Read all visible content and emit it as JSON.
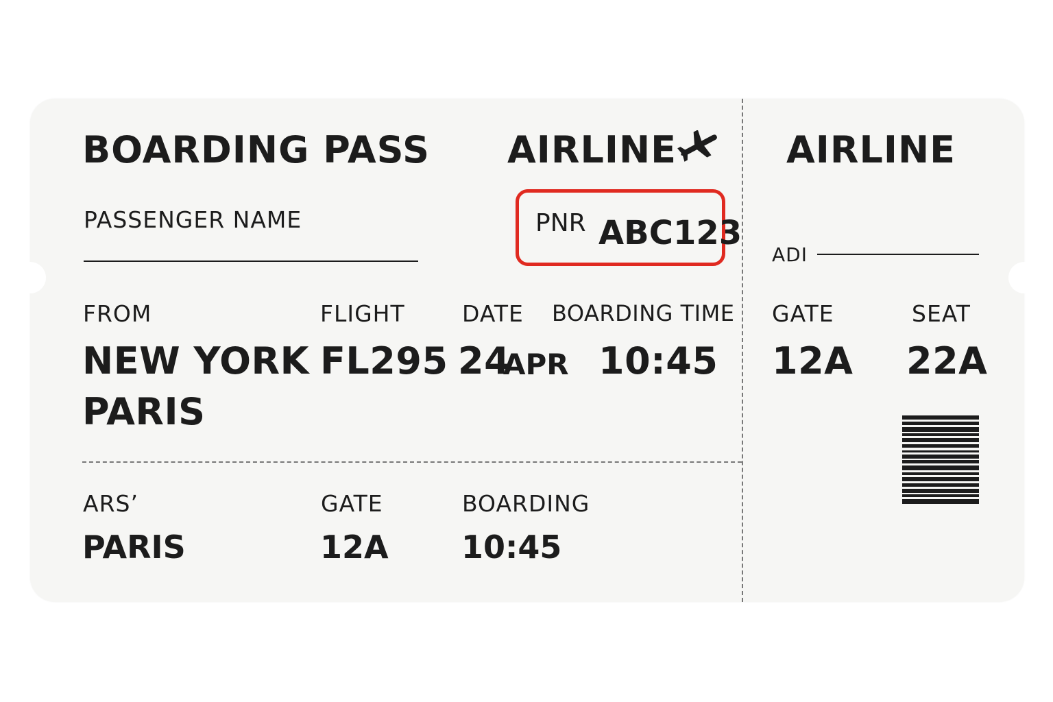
{
  "colors": {
    "pnr_highlight": "#e02a20",
    "ticket_bg": "#f6f6f4",
    "ink": "#1c1c1c"
  },
  "main": {
    "title": "BOARDING PASS",
    "airline": "AIRLINE",
    "airline_icon": "airplane-icon",
    "passenger_label": "PASSENGER NAME",
    "pnr_label": "PNR",
    "pnr_value": "ABC123",
    "from_label": "FROM",
    "from_value": "NEW YORK",
    "to_value": "PARIS",
    "flight_label": "FLIGHT",
    "flight_value": "FL295",
    "date_label": "DATE",
    "date_day": "24",
    "date_month": "APR",
    "boarding_time_label": "BOARDING TIME",
    "boarding_time_value": "10:45"
  },
  "lower": {
    "dest_label": "ARS’",
    "dest_value": "PARIS",
    "gate_label": "GATE",
    "gate_value": "12A",
    "boarding_label": "BOARDING",
    "boarding_value": "10:45"
  },
  "stub": {
    "airline": "AIRLINE",
    "adi_label": "ADI",
    "gate_label": "GATE",
    "gate_value": "12A",
    "seat_label": "SEAT",
    "seat_value": "22A"
  }
}
